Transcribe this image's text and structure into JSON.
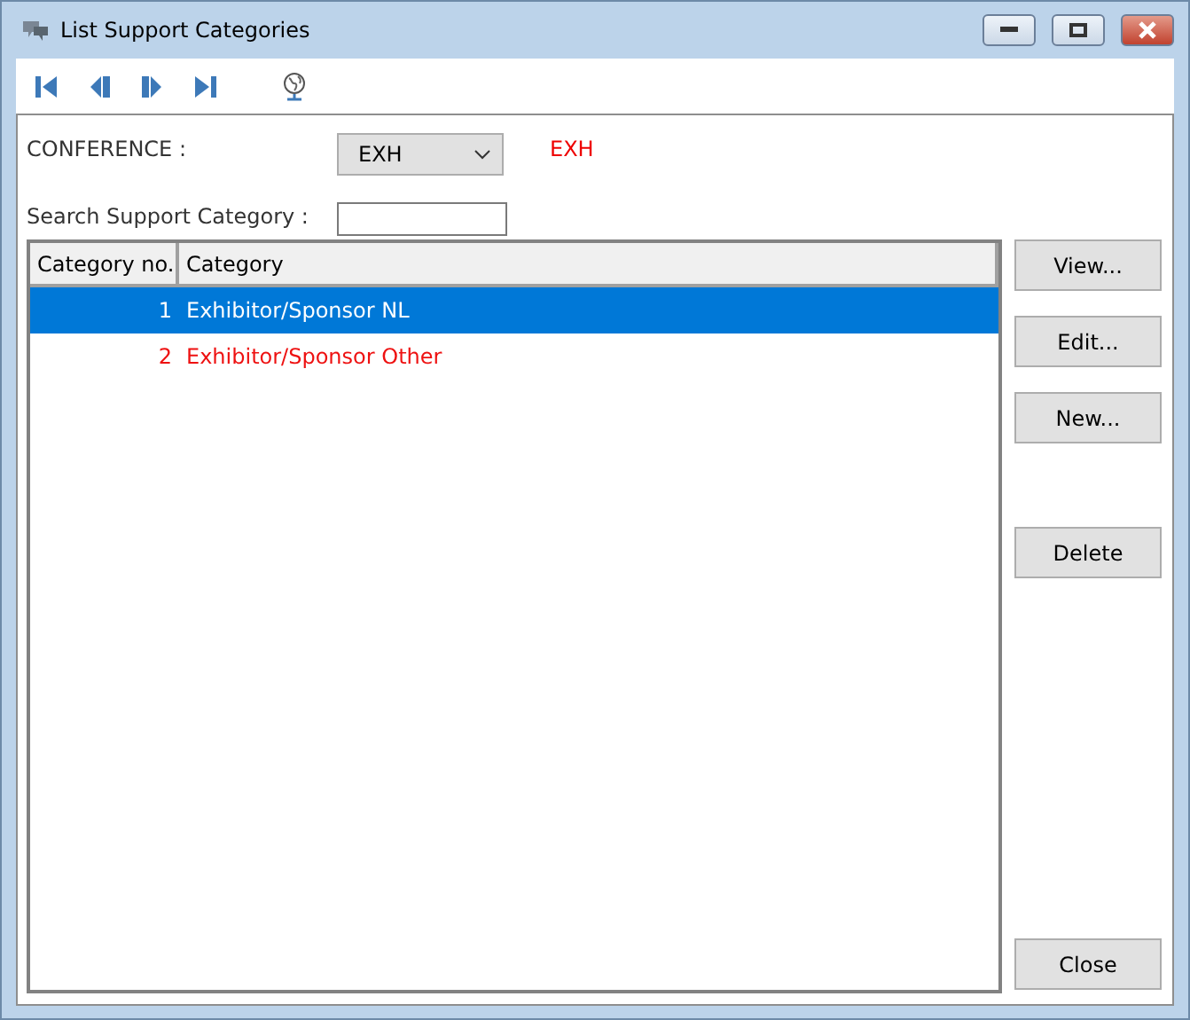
{
  "window": {
    "title": "List Support Categories"
  },
  "conference": {
    "label": "CONFERENCE :",
    "value": "EXH",
    "code": "EXH"
  },
  "search": {
    "label": "Search Support Category :"
  },
  "table": {
    "columns": [
      "Category no.",
      "Category"
    ],
    "rows": [
      {
        "no": "1",
        "category": "Exhibitor/Sponsor NL",
        "selected": true
      },
      {
        "no": "2",
        "category": "Exhibitor/Sponsor Other",
        "selected": false,
        "color": "#ee1111"
      }
    ]
  },
  "button_groups": [
    [
      "View...",
      "Edit...",
      "New..."
    ],
    [
      "Delete"
    ],
    [
      "Close"
    ]
  ]
}
